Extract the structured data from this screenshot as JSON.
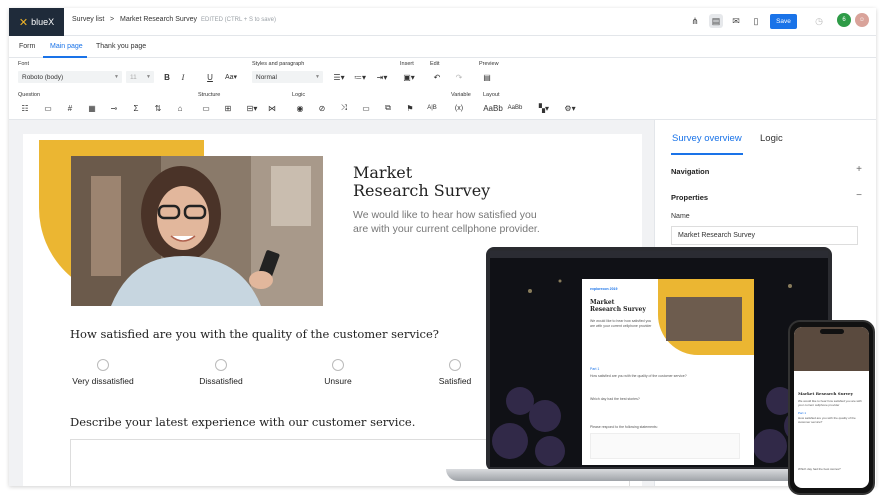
{
  "app": {
    "logo": "blueX",
    "breadcrumb": {
      "root": "Survey list",
      "separator": ">",
      "current": "Market Research Survey",
      "status": "EDITED (CTRL + S to save)"
    },
    "save_label": "Save",
    "avatar_initial": "6"
  },
  "tabs": [
    {
      "label": "Form"
    },
    {
      "label": "Main page"
    },
    {
      "label": "Thank you page"
    }
  ],
  "ribbon": {
    "groups": {
      "font": "Font",
      "styles": "Styles and paragraph",
      "insert": "Insert",
      "edit": "Edit",
      "preview": "Preview",
      "question": "Question",
      "structure": "Structure",
      "logic": "Logic",
      "variable": "Variable",
      "layout": "Layout"
    },
    "font_value": "Roboto (body)",
    "size_value": "11",
    "style_value": "Normal",
    "variable_symbol": "(x)",
    "layout_sample": "AaBb",
    "layout_sample_small": "AaBb"
  },
  "survey": {
    "title_line1": "Market",
    "title_line2": "Research Survey",
    "subtitle_line1": "We would like to hear how satisfied you",
    "subtitle_line2": "are with your current cellphone provider.",
    "q1": "How satisfied are you with the quality of the customer service?",
    "options": [
      "Very dissatisfied",
      "Dissatisfied",
      "Unsure",
      "Satisfied"
    ],
    "q2": "Describe your latest experience with our customer service."
  },
  "panel": {
    "tab_overview": "Survey overview",
    "tab_logic": "Logic",
    "navigation": "Navigation",
    "properties": "Properties",
    "name_label": "Name",
    "name_value": "Market Research Survey"
  },
  "device_preview": {
    "brand": "explorecon 2019",
    "title_line1": "Market",
    "title_line2": "Research Survey",
    "intro": "We would like to hear how satisfied you are with your current cellphone provider",
    "part": "Part 1",
    "q1": "How satisfied are you with the quality of the customer service?",
    "q2": "Which day had the best stories?",
    "q3": "Please respond to the following statements:"
  },
  "colors": {
    "accent": "#1a73e8",
    "brand_yellow": "#ebb632",
    "logo_bg": "#1f2b3a"
  }
}
